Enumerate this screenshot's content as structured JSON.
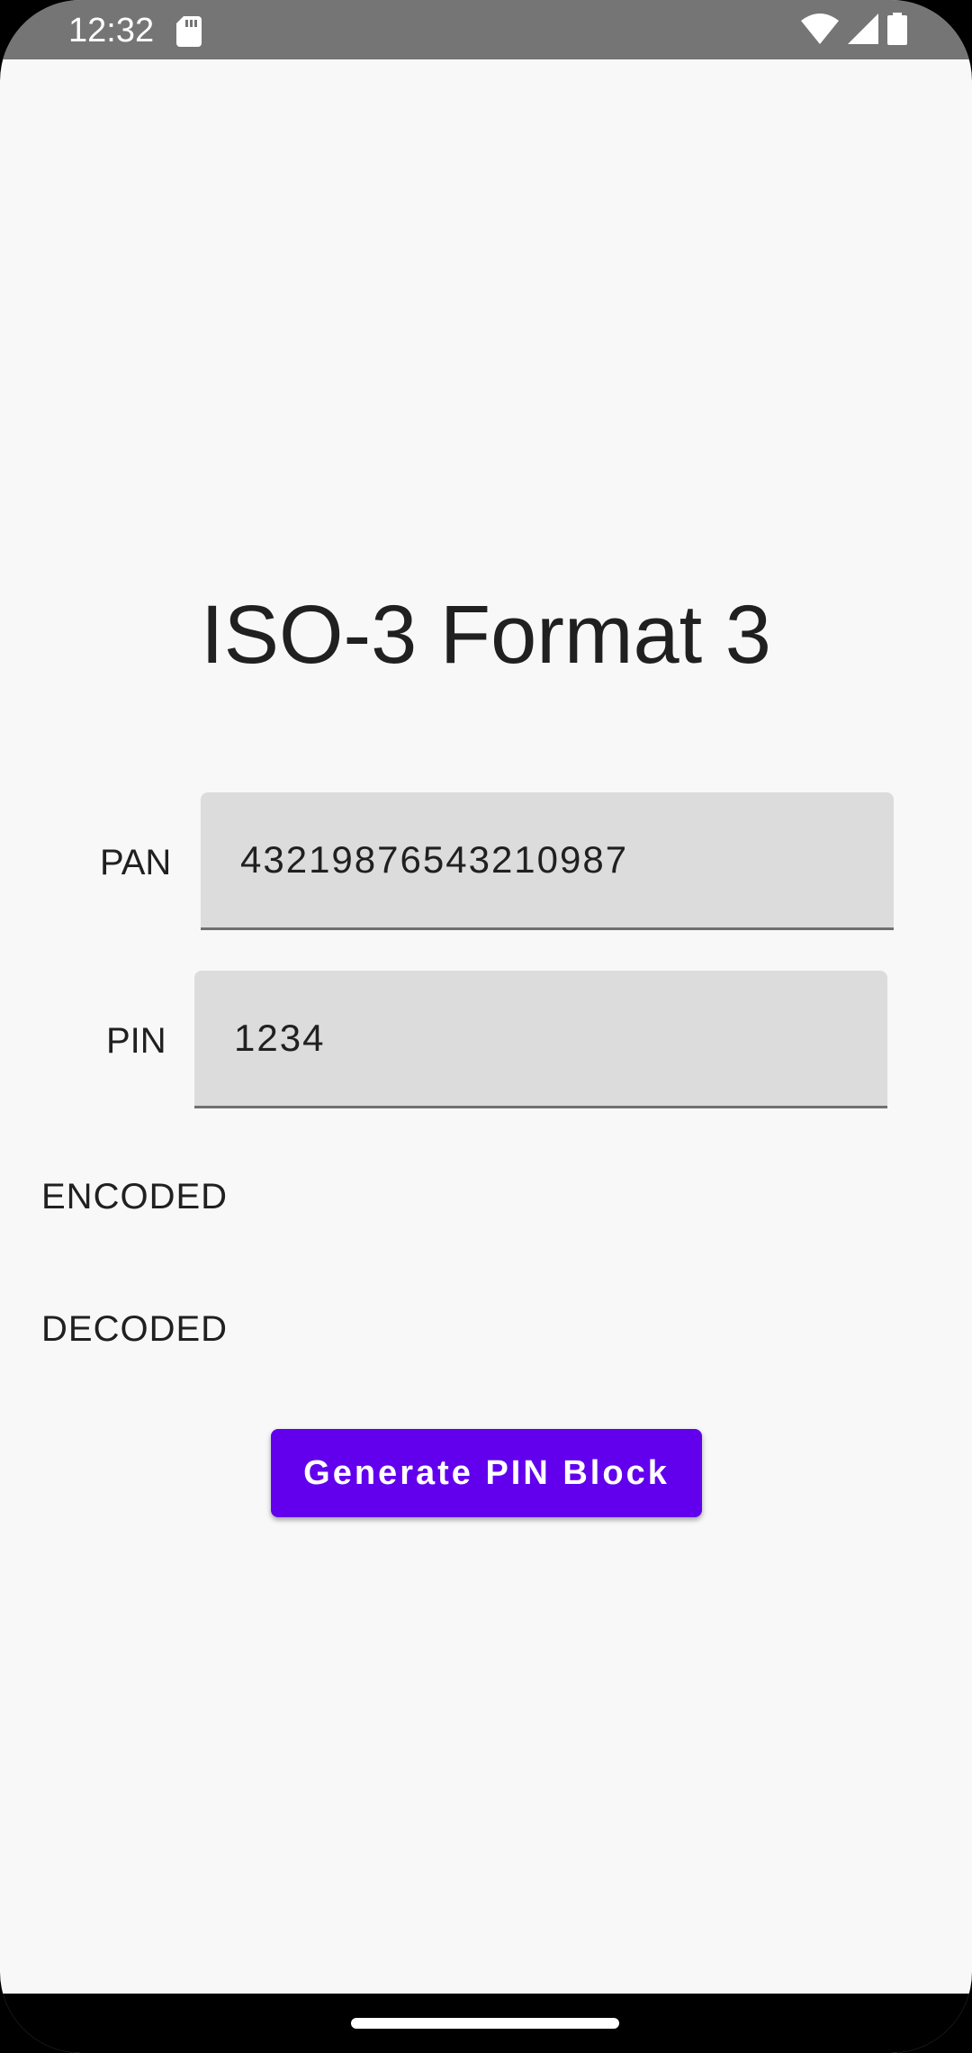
{
  "status_bar": {
    "time": "12:32",
    "icons": [
      "sd-card-icon",
      "wifi-icon",
      "signal-icon",
      "battery-icon"
    ]
  },
  "main": {
    "title": "ISO-3 Format 3",
    "pan": {
      "label": "PAN",
      "value": "4321987654321098­7"
    },
    "pin": {
      "label": "PIN",
      "value": "1234"
    },
    "encoded_label": "ENCODED",
    "decoded_label": "DECODED",
    "generate_button_label": "Generate PIN Block"
  },
  "colors": {
    "accent": "#6200ee",
    "status_bar": "#757575",
    "background": "#f8f8f8",
    "field_background": "#dcdcdc"
  }
}
